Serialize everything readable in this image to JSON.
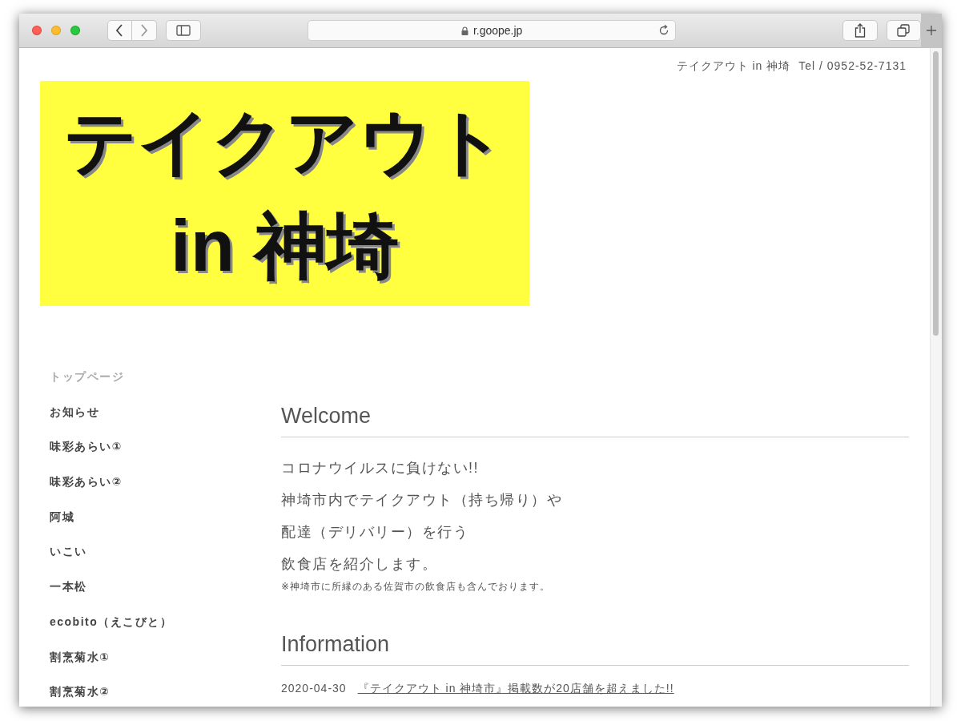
{
  "browser": {
    "url": "r.goope.jp"
  },
  "header": {
    "site_name": "テイクアウト in 神埼",
    "tel": "Tel / 0952-52-7131"
  },
  "banner": {
    "lines": [
      "テイクアウト",
      "in 神埼"
    ]
  },
  "nav": [
    {
      "label": "トップページ",
      "selected": true
    },
    {
      "label": "お知らせ",
      "selected": false
    },
    {
      "label": "味彩あらい①",
      "selected": false
    },
    {
      "label": "味彩あらい②",
      "selected": false
    },
    {
      "label": "阿城",
      "selected": false
    },
    {
      "label": "いこい",
      "selected": false
    },
    {
      "label": "一本松",
      "selected": false
    },
    {
      "label": "ecobito（えこびと）",
      "selected": false
    },
    {
      "label": "割烹菊水①",
      "selected": false
    },
    {
      "label": "割烹菊水②",
      "selected": false
    }
  ],
  "welcome": {
    "heading": "Welcome",
    "lines": [
      "コロナウイルスに負けない!!",
      "神埼市内でテイクアウト（持ち帰り）や",
      "配達（デリバリー）を行う",
      "飲食店を紹介します。"
    ],
    "note": "※神埼市に所縁のある佐賀市の飲食店も含んでおります。"
  },
  "information": {
    "heading": "Information",
    "items": [
      {
        "date": "2020-04-30",
        "title": "『テイクアウト in 神埼市』掲載数が20店舗を超えました!!"
      }
    ]
  }
}
